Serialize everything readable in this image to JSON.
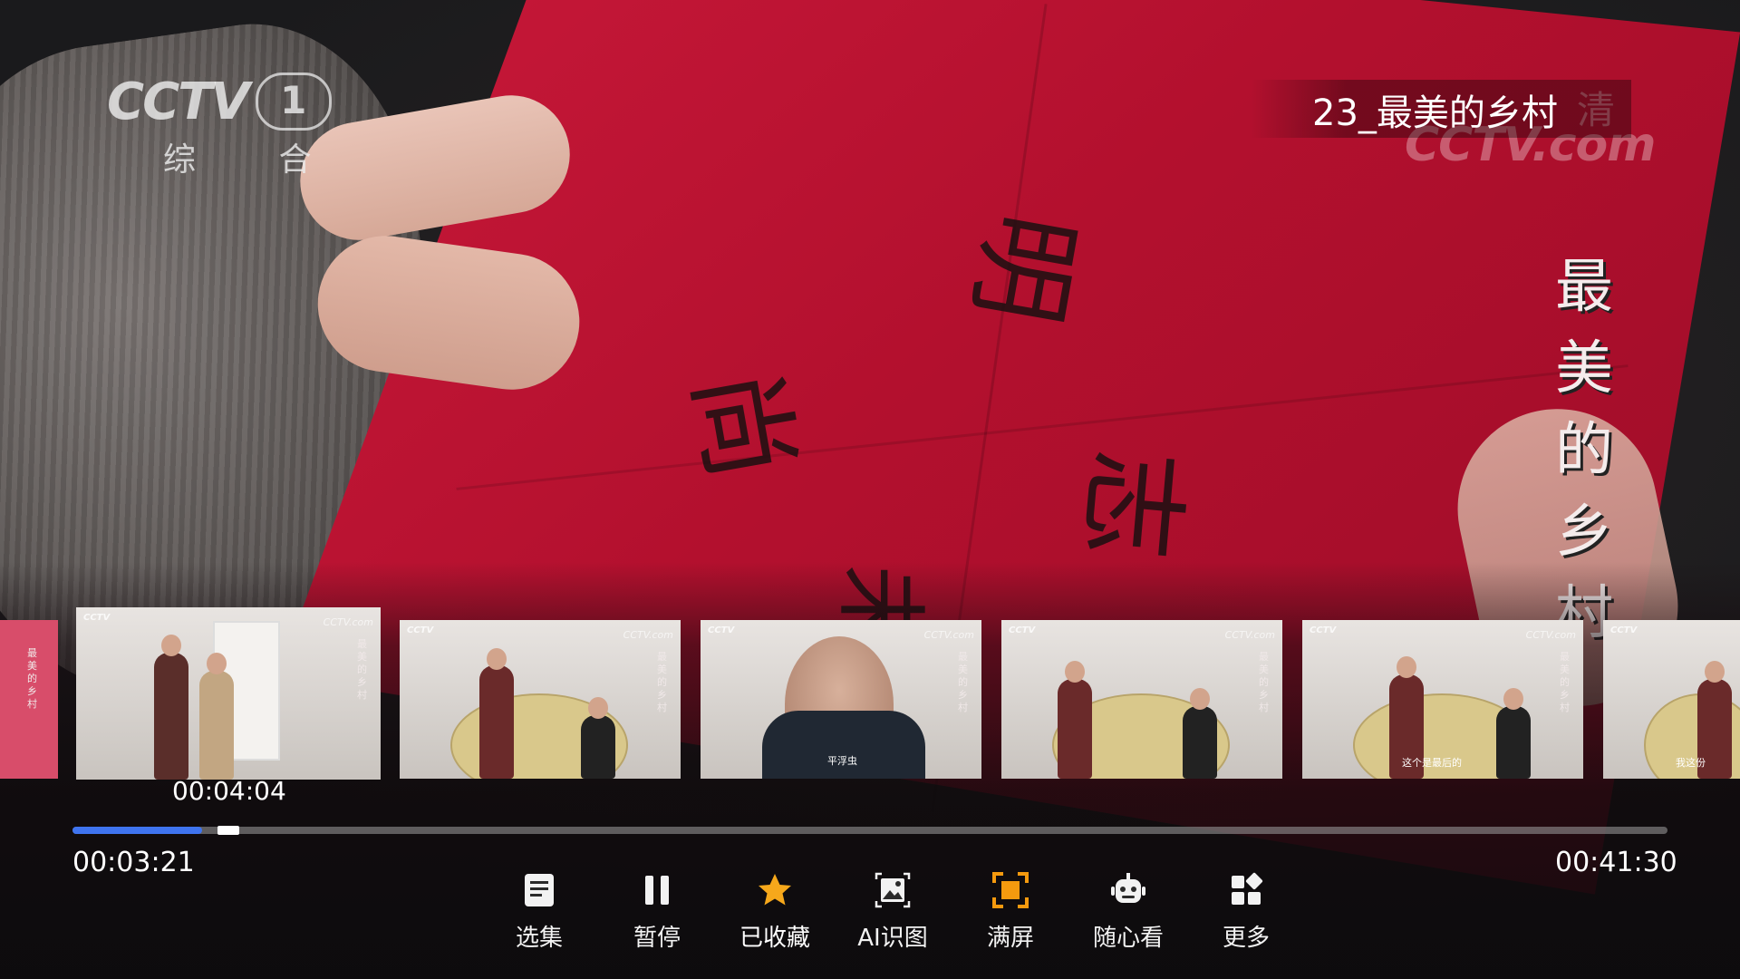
{
  "channel": {
    "brand": "CCTV",
    "number": "1",
    "sub": "综 合",
    "watermark": "CCTV.com",
    "hd_mark": "清"
  },
  "episode_title": "23_最美的乡村",
  "vertical_title": "最美的乡村",
  "calligraphy": [
    "明",
    "尚",
    "志",
    "未"
  ],
  "thumbnail_preview_time": "00:04:04",
  "progress": {
    "current": "00:03:21",
    "total": "00:41:30",
    "played_fraction": 0.081,
    "preview_fraction": 0.098
  },
  "controls": [
    {
      "id": "episodes",
      "label": "选集",
      "icon": "list-icon"
    },
    {
      "id": "pause",
      "label": "暂停",
      "icon": "pause-icon"
    },
    {
      "id": "favorite",
      "label": "已收藏",
      "icon": "star-icon"
    },
    {
      "id": "ai",
      "label": "AI识图",
      "icon": "ai-image-icon"
    },
    {
      "id": "fullscreen",
      "label": "满屏",
      "icon": "fullscreen-icon"
    },
    {
      "id": "random",
      "label": "随心看",
      "icon": "robot-icon"
    },
    {
      "id": "more",
      "label": "更多",
      "icon": "grid-icon"
    }
  ],
  "thumbnail_subtitles": [
    "平浮虫",
    "这个是最后的",
    "我这份"
  ],
  "colors": {
    "progress_fill": "#3f74ef",
    "icon_orange": "#f59a0e",
    "favorite_star": "#f6a81b"
  }
}
